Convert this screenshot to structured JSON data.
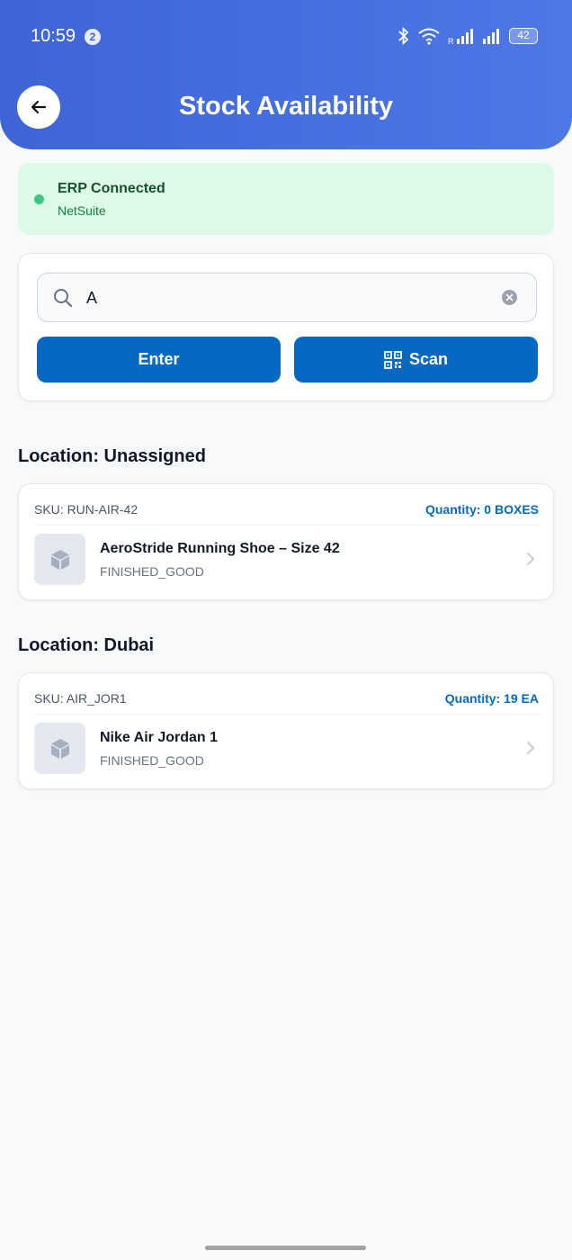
{
  "status_bar": {
    "time": "10:59",
    "notification_count": "2",
    "battery": "42"
  },
  "header": {
    "title": "Stock Availability",
    "colors": {
      "gradient_start": "#3f64d6",
      "gradient_end": "#4d78e6"
    }
  },
  "erp": {
    "title": "ERP Connected",
    "subtitle": "NetSuite",
    "colors": {
      "background": "#dcfae6",
      "dot": "#3fc584"
    }
  },
  "search": {
    "value": "A",
    "enter_label": "Enter",
    "scan_label": "Scan"
  },
  "groups": [
    {
      "heading": "Location: Unassigned",
      "item": {
        "sku": "SKU: RUN-AIR-42",
        "quantity": "Quantity: 0 BOXES",
        "name": "AeroStride Running Shoe – Size 42",
        "type": "FINISHED_GOOD"
      }
    },
    {
      "heading": "Location: Dubai",
      "item": {
        "sku": "SKU: AIR_JOR1",
        "quantity": "Quantity: 19 EA",
        "name": "Nike Air Jordan 1",
        "type": "FINISHED_GOOD"
      }
    }
  ],
  "icons": [
    "back-arrow-icon",
    "search-icon",
    "clear-icon",
    "qr-code-icon",
    "box-icon",
    "chevron-right-icon",
    "bluetooth-icon",
    "wifi-icon",
    "signal-icon",
    "battery-icon"
  ],
  "accent_color": "#0568c3"
}
